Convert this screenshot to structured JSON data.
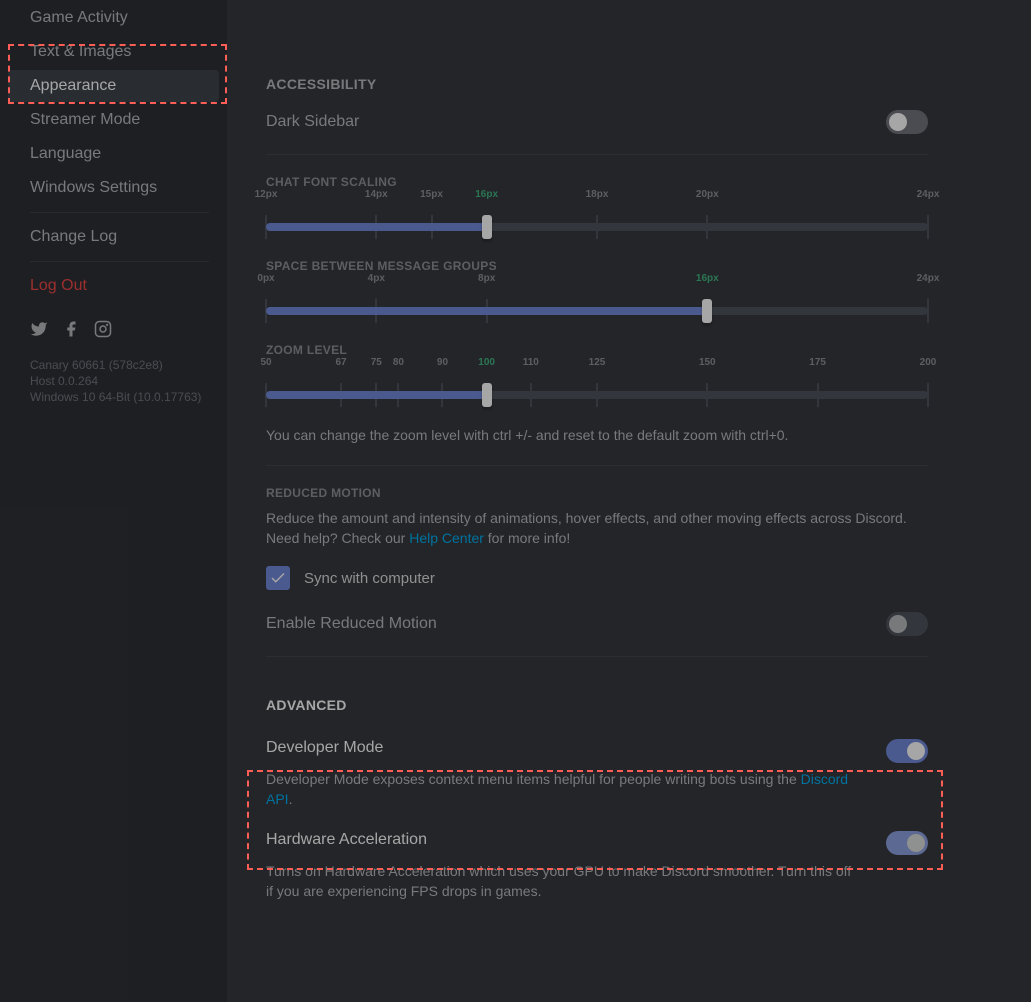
{
  "sidebar": {
    "items": [
      {
        "label": "Game Activity"
      },
      {
        "label": "Text & Images"
      },
      {
        "label": "Appearance",
        "active": true
      },
      {
        "label": "Streamer Mode"
      },
      {
        "label": "Language"
      },
      {
        "label": "Windows Settings"
      }
    ],
    "changelog": "Change Log",
    "logout": "Log Out",
    "version": {
      "line1": "Canary 60661 (578c2e8)",
      "line2": "Host 0.0.264",
      "line3": "Windows 10 64-Bit (10.0.17763)"
    }
  },
  "accessibility": {
    "title": "ACCESSIBILITY",
    "dark_sidebar": "Dark Sidebar",
    "chat_font": {
      "title": "CHAT FONT SCALING",
      "labels": [
        "12px",
        "14px",
        "15px",
        "16px",
        "18px",
        "20px",
        "24px"
      ],
      "positions": [
        0,
        16.66,
        25,
        33.33,
        50,
        66.66,
        100
      ],
      "active_index": 3,
      "fill_pct": 33.33
    },
    "space_groups": {
      "title": "SPACE BETWEEN MESSAGE GROUPS",
      "labels": [
        "0px",
        "4px",
        "8px",
        "16px",
        "24px"
      ],
      "positions": [
        0,
        16.66,
        33.33,
        66.66,
        100
      ],
      "active_index": 3,
      "fill_pct": 66.66
    },
    "zoom": {
      "title": "ZOOM LEVEL",
      "labels": [
        "50",
        "67",
        "75",
        "80",
        "90",
        "100",
        "110",
        "125",
        "150",
        "175",
        "200"
      ],
      "positions": [
        0,
        11.33,
        16.66,
        20,
        26.66,
        33.33,
        40,
        50,
        66.66,
        83.33,
        100
      ],
      "active_index": 5,
      "fill_pct": 33.33,
      "hint": "You can change the zoom level with ctrl +/- and reset to the default zoom with ctrl+0."
    },
    "reduced_motion": {
      "title": "REDUCED MOTION",
      "desc_pre": "Reduce the amount and intensity of animations, hover effects, and other moving effects across Discord. Need help? Check our ",
      "link": "Help Center",
      "desc_post": " for more info!",
      "sync_label": "Sync with computer",
      "enable_label": "Enable Reduced Motion"
    }
  },
  "advanced": {
    "title": "ADVANCED",
    "dev": {
      "title": "Developer Mode",
      "desc_pre": "Developer Mode exposes context menu items helpful for people writing bots using the ",
      "link": "Discord API",
      "desc_post": "."
    },
    "hw": {
      "title": "Hardware Acceleration",
      "desc": "Turns on Hardware Acceleration which uses your GPU to make Discord smoother. Turn this off if you are experiencing FPS drops in games."
    }
  }
}
